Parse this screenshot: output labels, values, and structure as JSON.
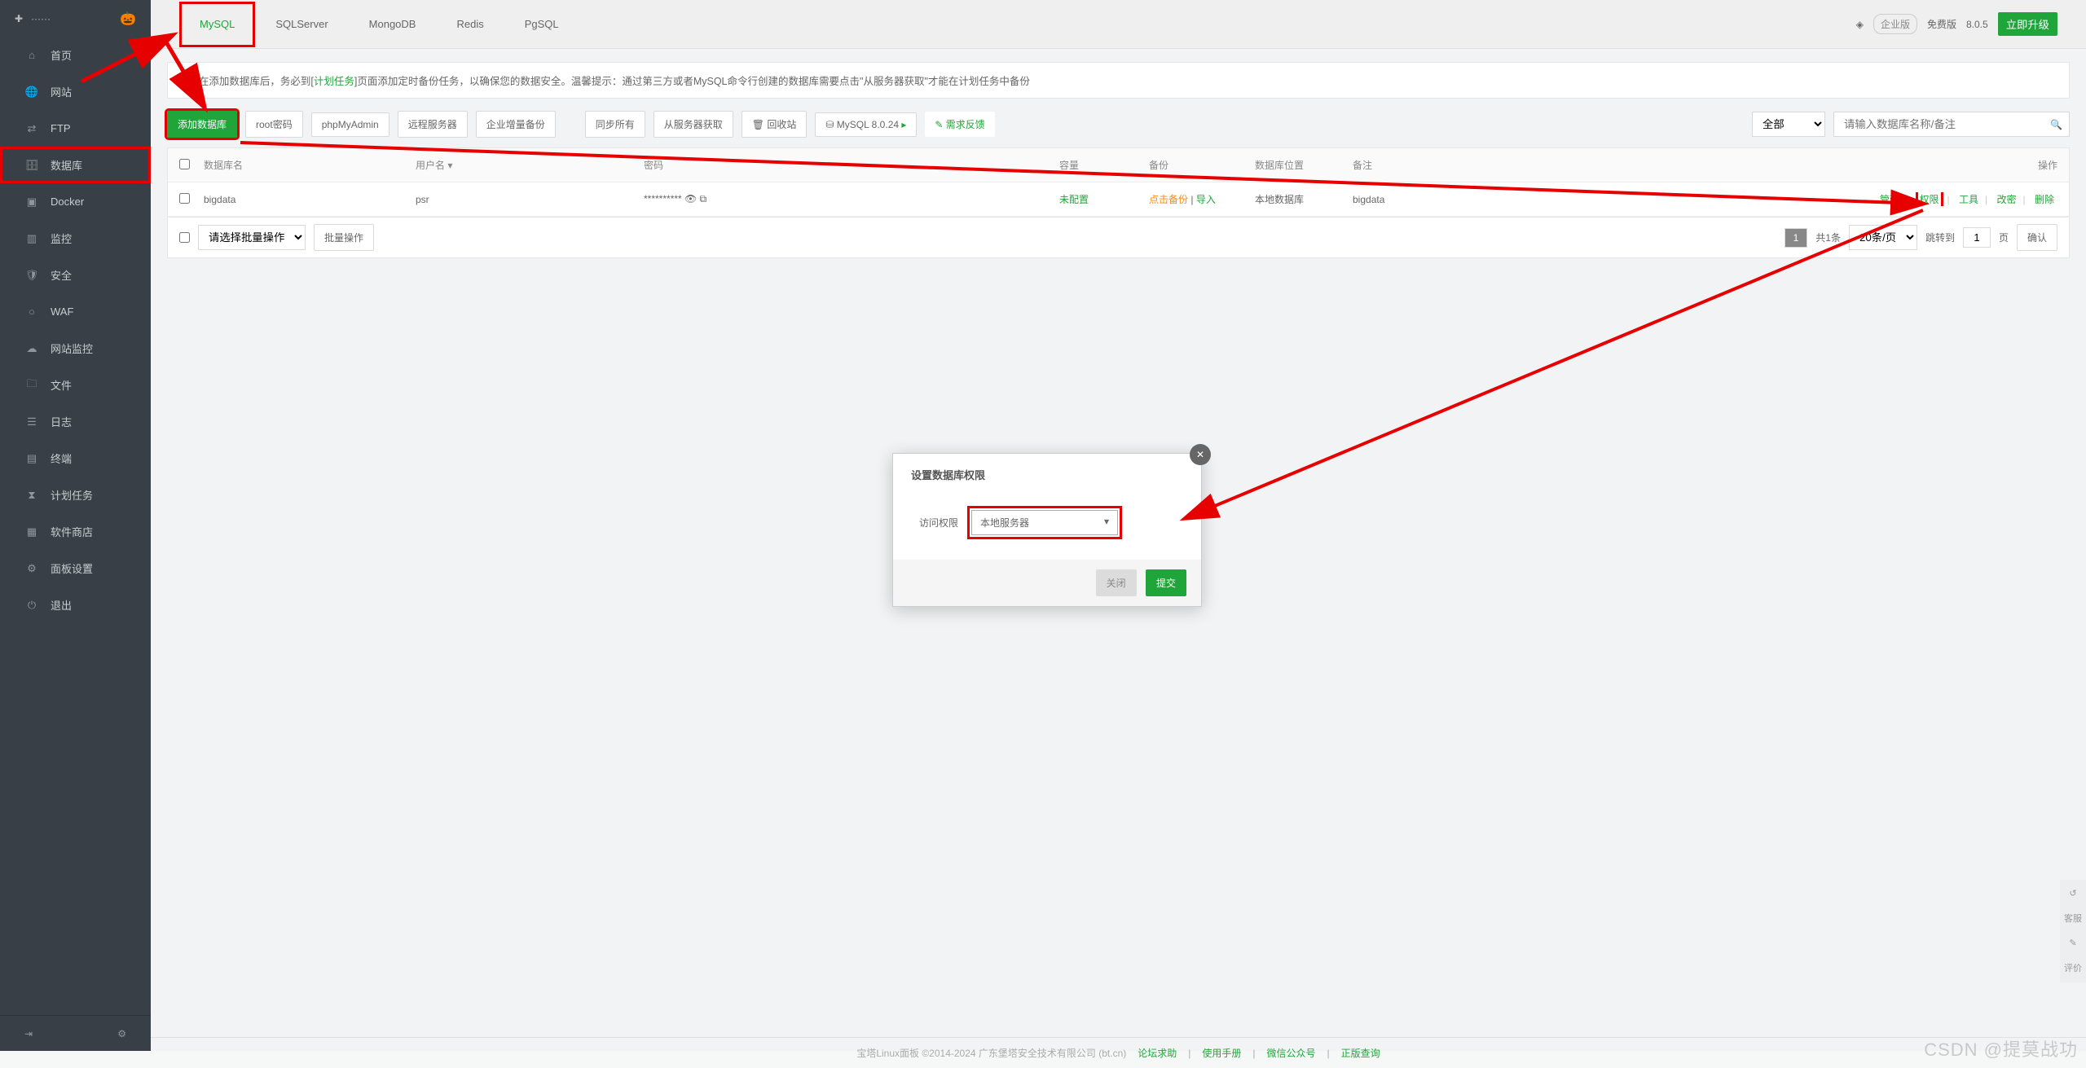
{
  "app": {
    "host": "······"
  },
  "sidebar": {
    "items": [
      {
        "icon": "⌂",
        "label": "首页"
      },
      {
        "icon": "🌐",
        "label": "网站"
      },
      {
        "icon": "⇄",
        "label": "FTP"
      },
      {
        "icon": "🗄",
        "label": "数据库",
        "hl": true
      },
      {
        "icon": "▣",
        "label": "Docker"
      },
      {
        "icon": "▥",
        "label": "监控"
      },
      {
        "icon": "🛡",
        "label": "安全"
      },
      {
        "icon": "○",
        "label": "WAF"
      },
      {
        "icon": "☁",
        "label": "网站监控"
      },
      {
        "icon": "🗀",
        "label": "文件"
      },
      {
        "icon": "☰",
        "label": "日志"
      },
      {
        "icon": "▤",
        "label": "终端"
      },
      {
        "icon": "⧗",
        "label": "计划任务"
      },
      {
        "icon": "▦",
        "label": "软件商店"
      },
      {
        "icon": "⚙",
        "label": "面板设置"
      },
      {
        "icon": "⏻",
        "label": "退出"
      }
    ]
  },
  "tabs": [
    "MySQL",
    "SQLServer",
    "MongoDB",
    "Redis",
    "PgSQL"
  ],
  "tabbar_right": {
    "pro": "企业版",
    "free": "免费版",
    "ver": "8.0.5",
    "upgrade": "立即升级"
  },
  "notice": {
    "text_a": "在添加数据库后，务必到[",
    "link": "计划任务",
    "text_b": "]页面添加定时备份任务，以确保您的数据安全。温馨提示：通过第三方或者MySQL命令行创建的数据库需要点击\"从服务器获取\"才能在计划任务中备份"
  },
  "toolbar": {
    "add": "添加数据库",
    "rootpwd": "root密码",
    "pma": "phpMyAdmin",
    "remote": "远程服务器",
    "inc": "企业增量备份",
    "syncall": "同步所有",
    "fetch": "从服务器获取",
    "recycle": "回收站",
    "mysqlver": "MySQL 8.0.24",
    "feedback": "需求反馈",
    "filter_all": "全部",
    "search_ph": "请输入数据库名称/备注"
  },
  "columns": {
    "name": "数据库名",
    "user": "用户名",
    "pwd": "密码",
    "quota": "容量",
    "bak": "备份",
    "loc": "数据库位置",
    "remark": "备注",
    "ops": "操作"
  },
  "row": {
    "name": "bigdata",
    "user": "psr",
    "pwd": "**********",
    "quota": "未配置",
    "bak_a": "点击备份",
    "bak_sep": " | ",
    "bak_b": "导入",
    "loc": "本地数据库",
    "remark": "bigdata",
    "ops": [
      "管理",
      "权限",
      "工具",
      "改密",
      "删除"
    ]
  },
  "batch": {
    "ph": "请选择批量操作",
    "btn": "批量操作",
    "count": "共1条",
    "per": "20条/页",
    "jump": "跳转到",
    "page": "页",
    "ok": "确认"
  },
  "modal": {
    "title": "设置数据库权限",
    "label": "访问权限",
    "value": "本地服务器",
    "close": "关闭",
    "submit": "提交"
  },
  "footer": {
    "copy": "宝塔Linux面板 ©2014-2024 广东堡塔安全技术有限公司 (bt.cn)",
    "links": [
      "论坛求助",
      "使用手册",
      "微信公众号",
      "正版查询"
    ]
  },
  "sidefloat": [
    "↺",
    "客服",
    "✎",
    "评价"
  ],
  "watermark": "CSDN @提莫战功"
}
